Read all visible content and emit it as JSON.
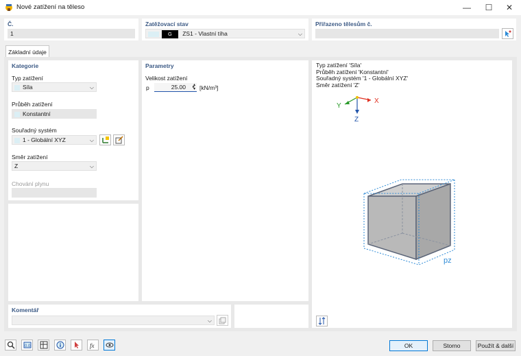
{
  "window": {
    "title": "Nové zatížení na těleso",
    "controls": {
      "minimize": "—",
      "maximize": "☐",
      "close": "✕"
    }
  },
  "number": {
    "label": "Č.",
    "value": "1"
  },
  "load_case": {
    "label": "Zatěžovací stav",
    "badge": "G",
    "value": "ZS1 - Vlastní tíha"
  },
  "assigned": {
    "label": "Přiřazeno tělesům č.",
    "value": ""
  },
  "tab": {
    "label": "Základní údaje"
  },
  "category": {
    "title": "Kategorie",
    "load_type_label": "Typ zatížení",
    "load_type_value": "Síla",
    "distribution_label": "Průběh zatížení",
    "distribution_value": "Konstantní",
    "coord_label": "Souřadný systém",
    "coord_value": "1 - Globální XYZ",
    "direction_label": "Směr zatížení",
    "direction_value": "Z",
    "gas_label": "Chování plynu",
    "gas_value": ""
  },
  "parameters": {
    "title": "Parametry",
    "magnitude_label": "Velikost zatížení",
    "symbol": "p",
    "value": "25.00",
    "unit": "[kN/m³]"
  },
  "info": {
    "line1": "Typ zatížení 'Síla'",
    "line2": "Průběh zatížení 'Konstantní'",
    "line3": "Souřadný systém '1 - Globální XYZ'",
    "line4": "Směr zatížení 'Z'"
  },
  "axes": {
    "x": "X",
    "y": "Y",
    "z": "Z"
  },
  "cube_label": "pz",
  "comment": {
    "label": "Komentář",
    "value": ""
  },
  "buttons": {
    "ok": "OK",
    "cancel": "Storno",
    "apply_next": "Použít & další"
  },
  "colors": {
    "header": "#3c5a85",
    "accent": "#0078d7",
    "swatch": "#dbeff5",
    "load_blue": "#2c8ad6"
  }
}
